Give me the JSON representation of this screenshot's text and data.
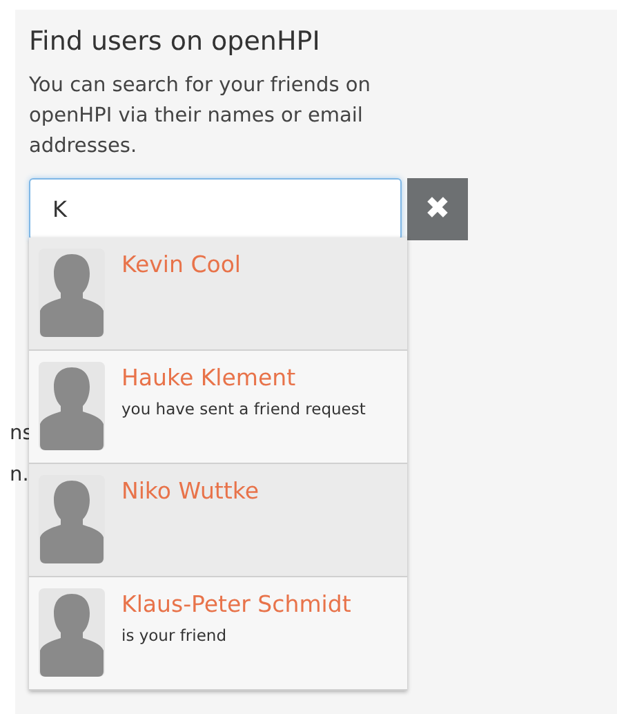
{
  "heading": "Find users on openHPI",
  "description": "You can search for your friends on openHPI via their names or email addresses.",
  "search": {
    "value": "K"
  },
  "clear_button": {
    "label": "✖"
  },
  "background_text": [
    "ns",
    "n."
  ],
  "results": [
    {
      "name": "Kevin Cool",
      "highlighted": true
    },
    {
      "name": "Hauke Klement",
      "status": "you have sent a friend request",
      "highlighted": false
    },
    {
      "name": "Niko Wuttke",
      "highlighted": true
    },
    {
      "name": "Klaus-Peter Schmidt",
      "status": "is your friend",
      "highlighted": false
    }
  ]
}
